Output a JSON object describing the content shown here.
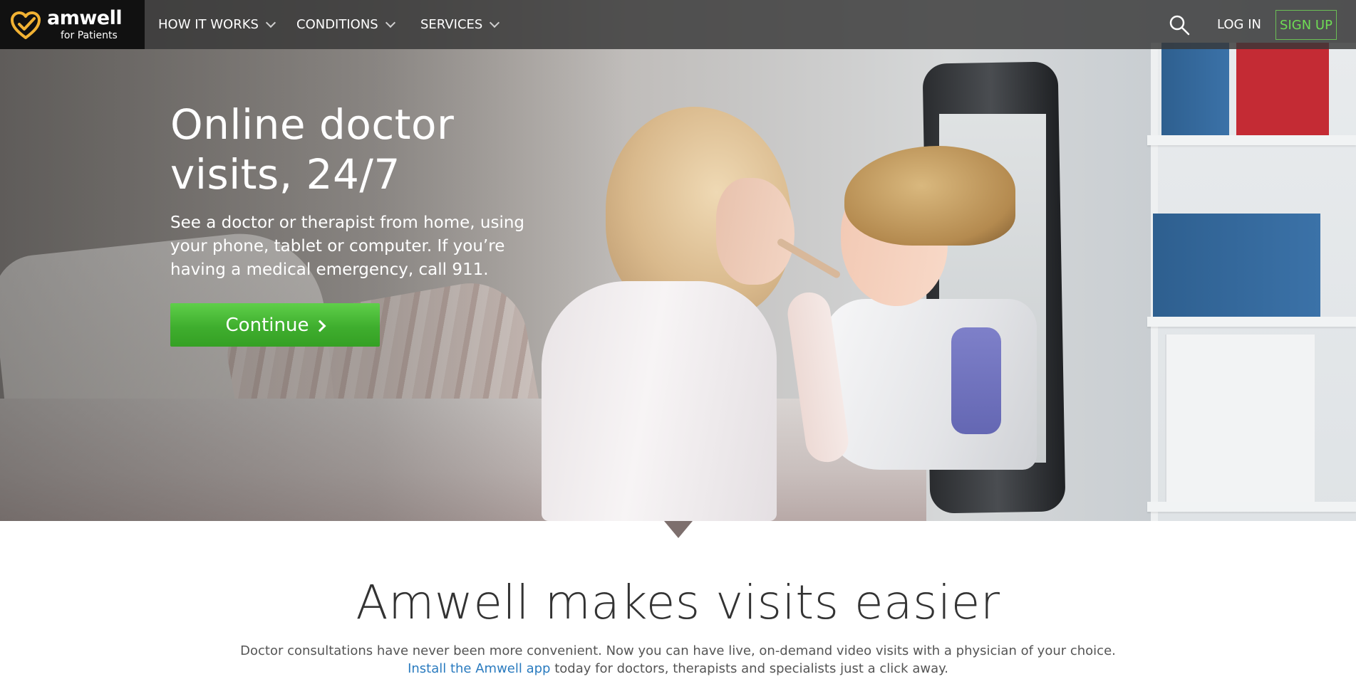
{
  "brand": {
    "name": "amwell",
    "subtitle": "for Patients",
    "accent": "#f2b233"
  },
  "nav": {
    "items": [
      {
        "label": "HOW IT WORKS"
      },
      {
        "label": "CONDITIONS"
      },
      {
        "label": "SERVICES"
      }
    ],
    "search_icon": "search-icon",
    "login": "LOG IN",
    "signup": "SIGN UP",
    "signup_color": "#6fdc55"
  },
  "hero": {
    "title": "Online doctor visits, 24/7",
    "description": "See a doctor or therapist from home, using your phone, tablet or computer. If you’re having a medical emergency, call 911.",
    "cta": "Continue",
    "cta_color": "#3fae2e"
  },
  "section": {
    "title": "Amwell makes visits easier",
    "text_line1": "Doctor consultations have never been more convenient. Now you can have live, on-demand video visits with a physician of your choice.",
    "link": "Install the Amwell app",
    "text_line2": " today for doctors, therapists and specialists just a click away.",
    "link_color": "#2a7bbf"
  }
}
